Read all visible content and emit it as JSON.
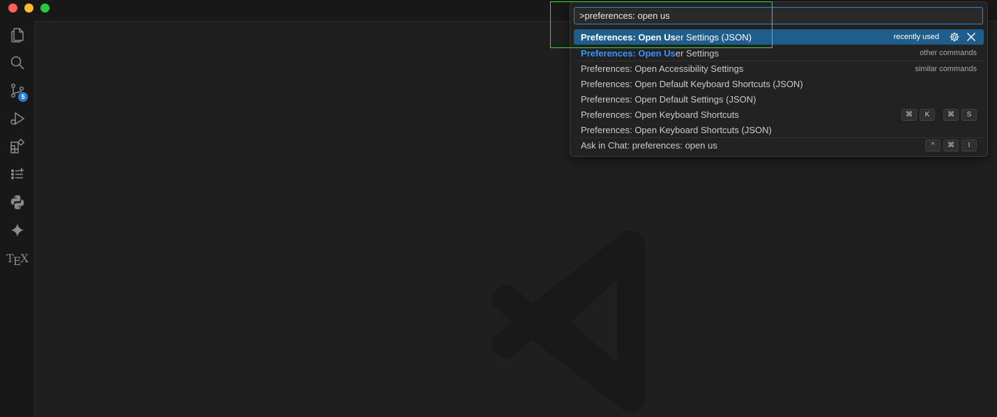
{
  "activity_bar": {
    "items": [
      {
        "name": "explorer",
        "icon": "files-icon"
      },
      {
        "name": "search",
        "icon": "search-icon"
      },
      {
        "name": "source-control",
        "icon": "source-control-icon",
        "badge": "5"
      },
      {
        "name": "run-and-debug",
        "icon": "run-debug-icon"
      },
      {
        "name": "extensions",
        "icon": "extensions-icon"
      },
      {
        "name": "testing",
        "icon": "testing-icon"
      },
      {
        "name": "python",
        "icon": "python-icon"
      },
      {
        "name": "copilot",
        "icon": "sparkle-icon"
      },
      {
        "name": "tex",
        "icon": "tex-icon",
        "label_t": "T",
        "label_e": "E",
        "label_x": "X"
      }
    ]
  },
  "quick_pick": {
    "input_value": ">preferences: open us",
    "items": [
      {
        "hl": "Preferences: Open Us",
        "rest": "er Settings (JSON)",
        "desc": "recently used",
        "selected": true
      },
      {
        "hl": "Preferences: Open Us",
        "rest": "er Settings",
        "desc": "other commands"
      },
      {
        "text": "Preferences: Open Accessibility Settings",
        "desc": "similar commands"
      },
      {
        "text": "Preferences: Open Default Keyboard Shortcuts (JSON)"
      },
      {
        "text": "Preferences: Open Default Settings (JSON)"
      },
      {
        "text": "Preferences: Open Keyboard Shortcuts",
        "keys": [
          "⌘",
          "K",
          "⌘",
          "S"
        ]
      },
      {
        "text": "Preferences: Open Keyboard Shortcuts (JSON)"
      },
      {
        "text": "Ask in Chat: preferences: open us",
        "keys": [
          "^",
          "⌘",
          "I"
        ]
      }
    ]
  },
  "colors": {
    "selection": "#1f5e8c",
    "highlight_match": "#3794ff",
    "input_border": "#2d86d6",
    "badge": "#2b7cd3",
    "annotation_box": "#33e033"
  }
}
